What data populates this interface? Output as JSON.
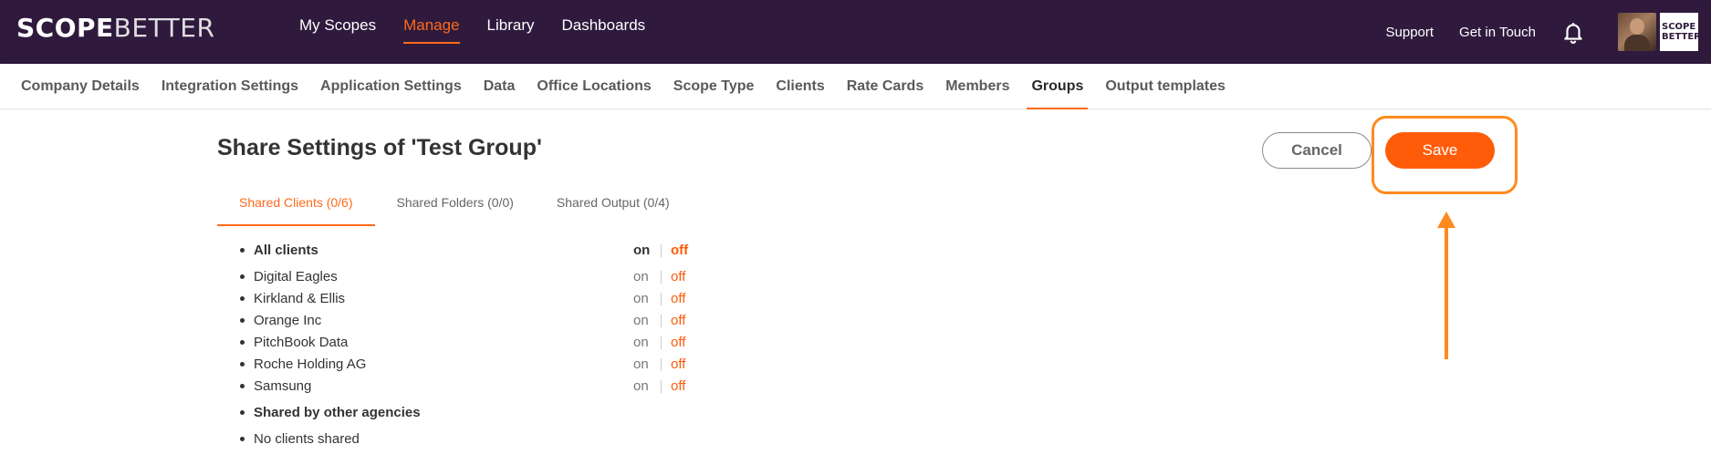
{
  "brand": {
    "name_part1": "SCOPE",
    "name_part2": "BETTER",
    "mini_line1": "SCOPE",
    "mini_line2": "BETTER"
  },
  "main_nav": [
    {
      "label": "My Scopes",
      "active": false
    },
    {
      "label": "Manage",
      "active": true
    },
    {
      "label": "Library",
      "active": false
    },
    {
      "label": "Dashboards",
      "active": false
    }
  ],
  "top_right": {
    "support": "Support",
    "get_in_touch": "Get in Touch"
  },
  "sub_nav": [
    {
      "label": "Company Details",
      "active": false
    },
    {
      "label": "Integration Settings",
      "active": false
    },
    {
      "label": "Application Settings",
      "active": false
    },
    {
      "label": "Data",
      "active": false
    },
    {
      "label": "Office Locations",
      "active": false
    },
    {
      "label": "Scope Type",
      "active": false
    },
    {
      "label": "Clients",
      "active": false
    },
    {
      "label": "Rate Cards",
      "active": false
    },
    {
      "label": "Members",
      "active": false
    },
    {
      "label": "Groups",
      "active": true
    },
    {
      "label": "Output templates",
      "active": false
    }
  ],
  "page": {
    "title": "Share Settings of 'Test Group'",
    "cancel_label": "Cancel",
    "save_label": "Save"
  },
  "tabs": [
    {
      "label": "Shared Clients (0/6)",
      "active": true
    },
    {
      "label": "Shared Folders (0/0)",
      "active": false
    },
    {
      "label": "Shared Output (0/4)",
      "active": false
    }
  ],
  "clients": {
    "all_clients": {
      "label": "All clients",
      "on": "on",
      "off": "off"
    },
    "items": [
      {
        "label": "Digital Eagles",
        "on": "on",
        "off": "off"
      },
      {
        "label": "Kirkland & Ellis",
        "on": "on",
        "off": "off"
      },
      {
        "label": "Orange Inc",
        "on": "on",
        "off": "off"
      },
      {
        "label": "PitchBook Data",
        "on": "on",
        "off": "off"
      },
      {
        "label": "Roche Holding AG",
        "on": "on",
        "off": "off"
      },
      {
        "label": "Samsung",
        "on": "on",
        "off": "off"
      }
    ],
    "other_agencies_heading": "Shared by other agencies",
    "no_clients_shared": "No clients shared"
  },
  "colors": {
    "accent": "#ff5c0a",
    "topbar": "#2f1a3d",
    "highlight": "#ff8a1e"
  },
  "icons": {
    "notifications": "bell-icon",
    "annotation": "arrow-up-icon"
  }
}
